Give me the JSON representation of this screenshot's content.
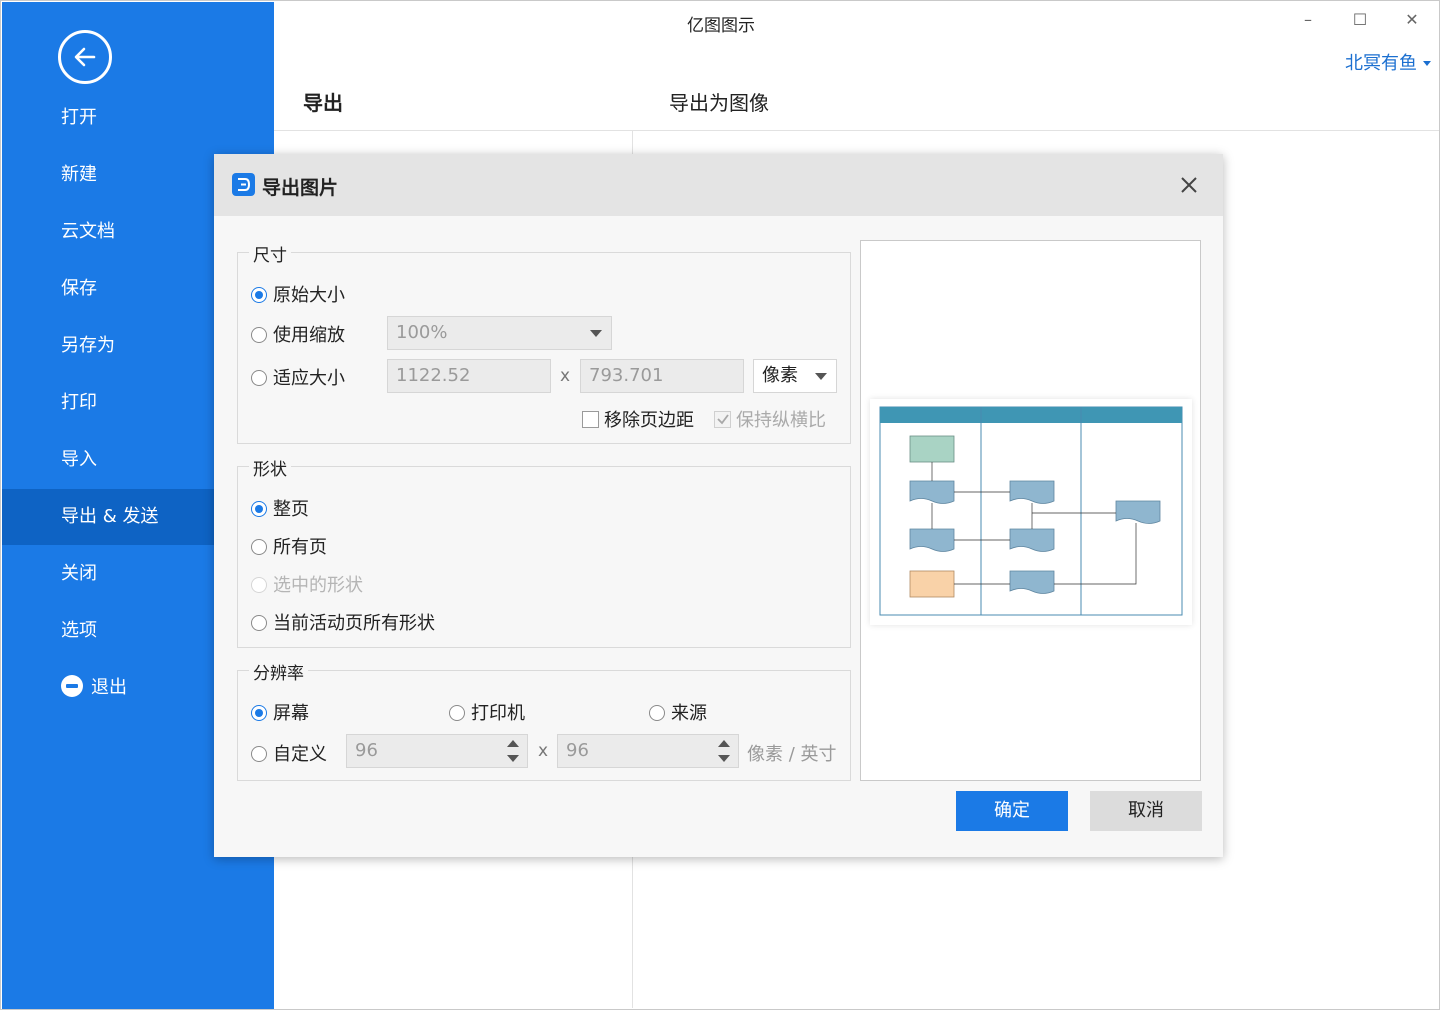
{
  "window": {
    "title": "亿图图示",
    "minimize_glyph": "–",
    "maximize_glyph": "☐",
    "close_glyph": "✕",
    "user_name": "北冥有鱼"
  },
  "sidebar": {
    "items": [
      {
        "label": "打开"
      },
      {
        "label": "新建"
      },
      {
        "label": "云文档"
      },
      {
        "label": "保存"
      },
      {
        "label": "另存为"
      },
      {
        "label": "打印"
      },
      {
        "label": "导入"
      },
      {
        "label": "导出 & 发送",
        "active": true
      },
      {
        "label": "关闭"
      },
      {
        "label": "选项"
      },
      {
        "label": "退出",
        "icon": "exit-icon"
      }
    ]
  },
  "panel": {
    "heading": "导出",
    "subheading": "导出为图像"
  },
  "dialog": {
    "title": "导出图片",
    "size": {
      "legend": "尺寸",
      "original_size": "原始大小",
      "use_zoom": "使用缩放",
      "zoom_value": "100%",
      "fit_size": "适应大小",
      "width": "1122.52",
      "height": "793.701",
      "times": "x",
      "unit": "像素",
      "remove_margin": "移除页边距",
      "keep_ratio": "保持纵横比"
    },
    "shape": {
      "legend": "形状",
      "whole_page": "整页",
      "all_pages": "所有页",
      "selected_shapes": "选中的形状",
      "active_page_all_shapes": "当前活动页所有形状"
    },
    "resolution": {
      "legend": "分辨率",
      "screen": "屏幕",
      "printer": "打印机",
      "source": "来源",
      "custom": "自定义",
      "x_dpi": "96",
      "y_dpi": "96",
      "times": "x",
      "unit": "像素 / 英寸"
    },
    "ok_label": "确定",
    "cancel_label": "取消"
  },
  "colors": {
    "sidebar_blue": "#1b7ae6",
    "sidebar_active": "#0e63c4",
    "link_blue": "#1b6fd0",
    "preview_header": "#3f96b4",
    "preview_shape": "#8fb6cf",
    "preview_start": "#a9d3c4",
    "preview_orange": "#f9d2a8"
  }
}
